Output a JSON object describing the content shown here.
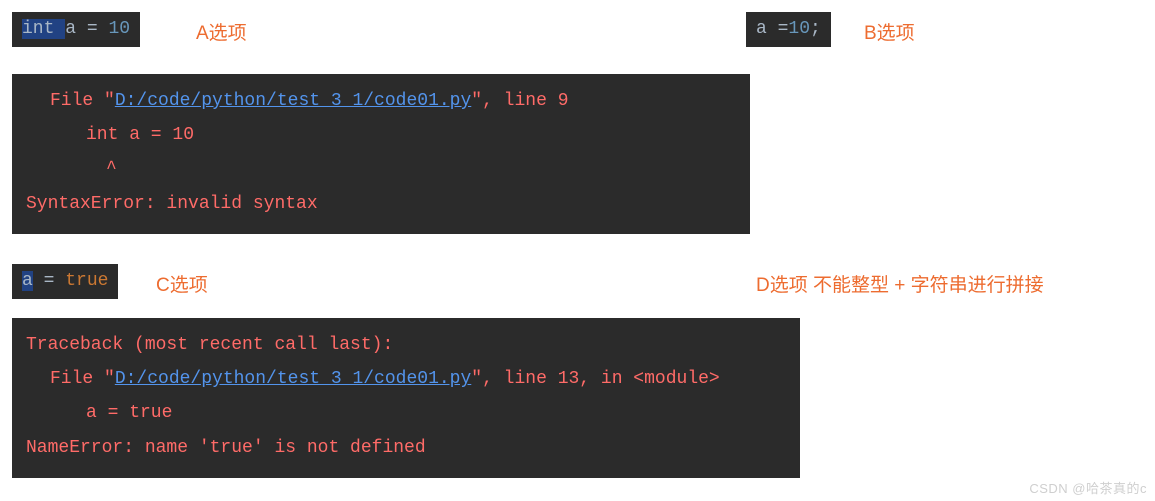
{
  "optionA": {
    "code_html": "<span class='sel'>int </span><span>a = </span><span class='kw-num'>10</span>",
    "label": "A选项"
  },
  "optionB": {
    "code_html": "a =<span class='kw-num'>10</span><span class='grey'>;</span>",
    "label": "B选项"
  },
  "optionC": {
    "code_html": "<span class='sel'>a</span> = <span class='kw-orange'>true</span>",
    "label": "C选项"
  },
  "optionD": {
    "label": "D选项 不能整型 + 字符串进行拼接"
  },
  "errorA": {
    "line1_pre": "File \"",
    "line1_link": "D:/code/python/test_3_1/code01.py",
    "line1_post": "\", line 9",
    "line2": "int a = 10",
    "line3": "^",
    "line4": "SyntaxError: invalid syntax"
  },
  "errorC": {
    "line1": "Traceback (most recent call last):",
    "line2_pre": "File \"",
    "line2_link": "D:/code/python/test_3_1/code01.py",
    "line2_post": "\", line 13, in <module>",
    "line3": "a = true",
    "line4": "NameError: name 'true' is not defined"
  },
  "watermark": "CSDN @哈茶真的c"
}
